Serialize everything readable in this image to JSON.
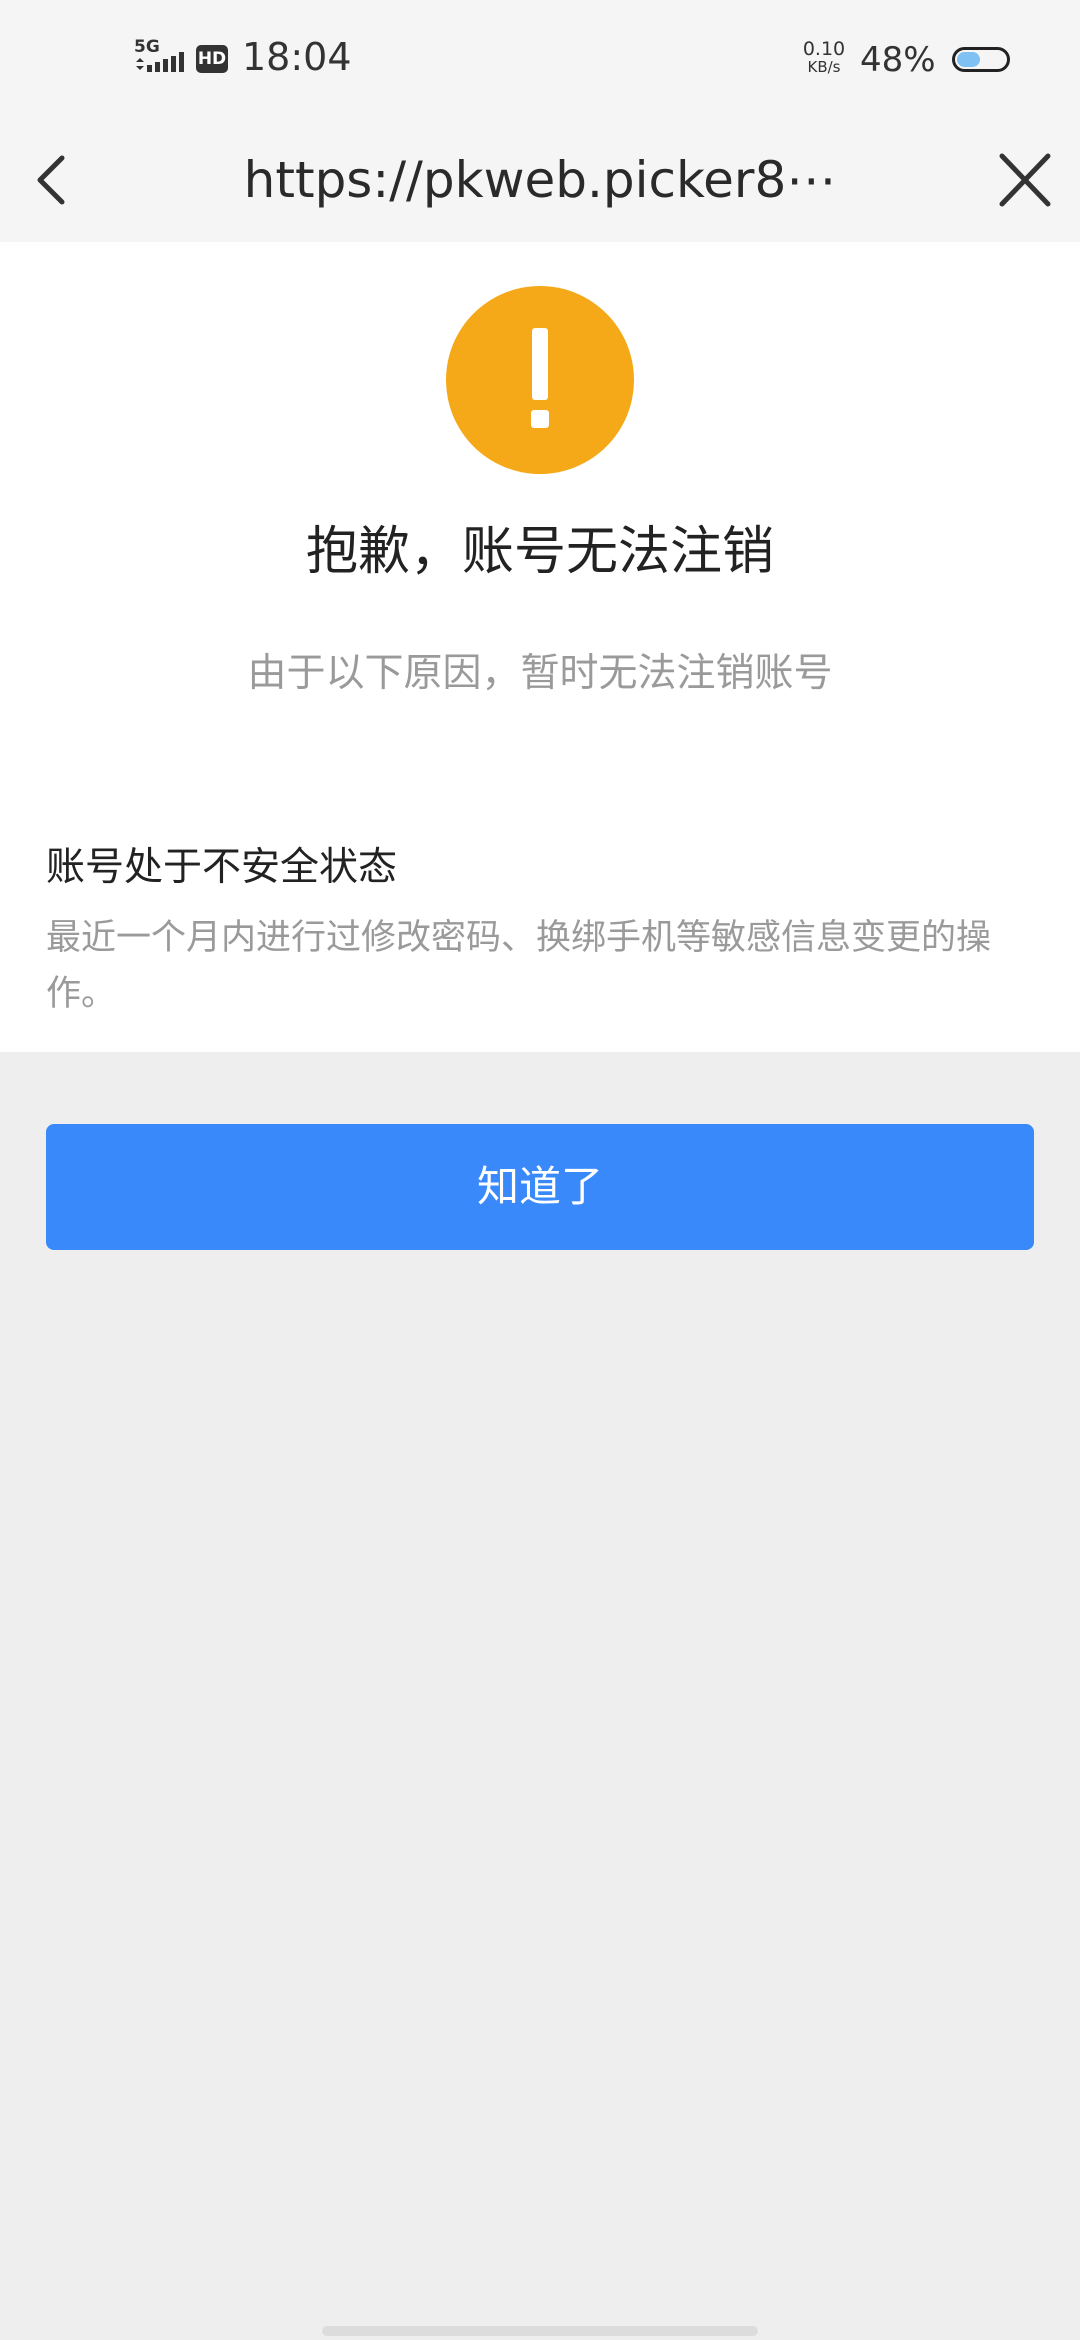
{
  "status_bar": {
    "network": "5G",
    "hd": "HD",
    "time": "18:04",
    "speed_value": "0.10",
    "speed_unit": "KB/s",
    "battery_percent": "48%",
    "battery_level": 0.48
  },
  "nav": {
    "url": "https://pkweb.picker8⋯",
    "back_icon": "chevron-left-icon",
    "close_icon": "close-icon"
  },
  "main": {
    "icon": "warning-icon",
    "title": "抱歉，账号无法注销",
    "subtitle": "由于以下原因，暂时无法注销账号",
    "reason": {
      "title": "账号处于不安全状态",
      "description": "最近一个月内进行过修改密码、换绑手机等敏感信息变更的操作。"
    }
  },
  "button": {
    "label": "知道了"
  },
  "colors": {
    "accent": "#3a89fb",
    "warning": "#f5a918"
  }
}
